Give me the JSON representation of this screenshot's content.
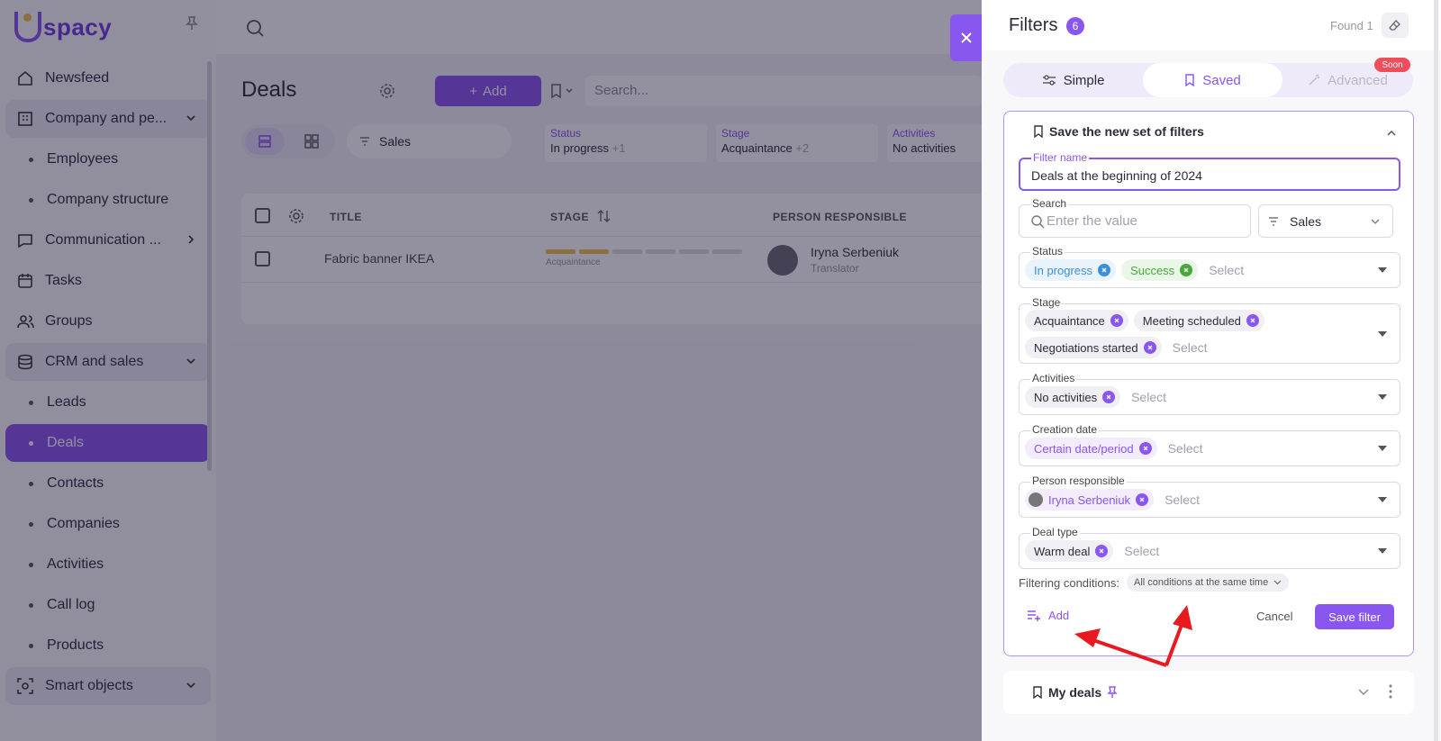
{
  "app": {
    "logo_text": "spacy",
    "brand_color": "#8a56f0"
  },
  "sidebar": {
    "items": [
      {
        "label": "Newsfeed",
        "icon": "home-icon",
        "type": "item"
      },
      {
        "label": "Company and pe...",
        "icon": "building-icon",
        "type": "group",
        "chevron": "down"
      },
      {
        "label": "Employees",
        "type": "sub"
      },
      {
        "label": "Company structure",
        "type": "sub"
      },
      {
        "label": "Communication ...",
        "icon": "chat-icon",
        "type": "item",
        "chevron": "right"
      },
      {
        "label": "Tasks",
        "icon": "calendar-icon",
        "type": "item"
      },
      {
        "label": "Groups",
        "icon": "users-icon",
        "type": "item"
      },
      {
        "label": "CRM and sales",
        "icon": "database-icon",
        "type": "group",
        "chevron": "down"
      },
      {
        "label": "Leads",
        "type": "sub"
      },
      {
        "label": "Deals",
        "type": "sub",
        "active": true
      },
      {
        "label": "Contacts",
        "type": "sub"
      },
      {
        "label": "Companies",
        "type": "sub"
      },
      {
        "label": "Activities",
        "type": "sub"
      },
      {
        "label": "Call log",
        "type": "sub"
      },
      {
        "label": "Products",
        "type": "sub"
      },
      {
        "label": "Smart objects",
        "icon": "scan-icon",
        "type": "group",
        "chevron": "down"
      }
    ]
  },
  "main": {
    "title": "Deals",
    "add_label": "Add",
    "search_placeholder": "Search...",
    "pipeline": "Sales",
    "chip_filters": [
      {
        "label": "Status",
        "value": "In progress",
        "extra": "+1"
      },
      {
        "label": "Stage",
        "value": "Acquaintance",
        "extra": "+2"
      },
      {
        "label": "Activities",
        "value": "No activities",
        "extra": ""
      }
    ],
    "table": {
      "columns": [
        "TITLE",
        "STAGE",
        "PERSON RESPONSIBLE"
      ],
      "rows": [
        {
          "title": "Fabric banner IKEA",
          "stage": "Acquaintance",
          "stage_progress": 2,
          "stage_total": 6,
          "person": "Iryna Serbeniuk",
          "role": "Translator"
        }
      ]
    }
  },
  "panel": {
    "title": "Filters",
    "count": "6",
    "found": "Found 1",
    "tabs": [
      {
        "label": "Simple",
        "icon": "sliders-icon"
      },
      {
        "label": "Saved",
        "icon": "bookmark-icon",
        "active": true
      },
      {
        "label": "Advanced",
        "icon": "magic-wand-icon"
      }
    ],
    "soon_badge": "Soon",
    "save_section": {
      "title": "Save the new set of filters",
      "filter_name_label": "Filter name",
      "filter_name_value": "Deals at the beginning of 2024",
      "search_label": "Search",
      "search_placeholder": "Enter the value",
      "pipeline_value": "Sales",
      "fields": [
        {
          "key": "status",
          "label": "Status",
          "tags": [
            {
              "text": "In progress",
              "color": "blue"
            },
            {
              "text": "Success",
              "color": "green"
            }
          ],
          "placeholder": "Select"
        },
        {
          "key": "stage",
          "label": "Stage",
          "tags": [
            {
              "text": "Acquaintance",
              "color": "gray"
            },
            {
              "text": "Meeting scheduled",
              "color": "gray"
            },
            {
              "text": "Negotiations started",
              "color": "gray"
            }
          ],
          "placeholder": "Select"
        },
        {
          "key": "activities",
          "label": "Activities",
          "tags": [
            {
              "text": "No activities",
              "color": "gray"
            }
          ],
          "placeholder": "Select"
        },
        {
          "key": "creation_date",
          "label": "Creation date",
          "tags": [
            {
              "text": "Certain date/period",
              "color": "purple"
            }
          ],
          "placeholder": "Select"
        },
        {
          "key": "person",
          "label": "Person responsible",
          "tags": [
            {
              "text": "Iryna Serbeniuk",
              "color": "purple",
              "avatar": true
            }
          ],
          "placeholder": "Select"
        },
        {
          "key": "deal_type",
          "label": "Deal type",
          "tags": [
            {
              "text": "Warm deal",
              "color": "gray"
            }
          ],
          "placeholder": "Select"
        }
      ],
      "conditions_label": "Filtering conditions:",
      "conditions_value": "All conditions at the same time",
      "add_label": "Add",
      "cancel_label": "Cancel",
      "save_label": "Save filter"
    },
    "saved_sets": [
      {
        "label": "My deals",
        "pinned": true
      }
    ]
  }
}
